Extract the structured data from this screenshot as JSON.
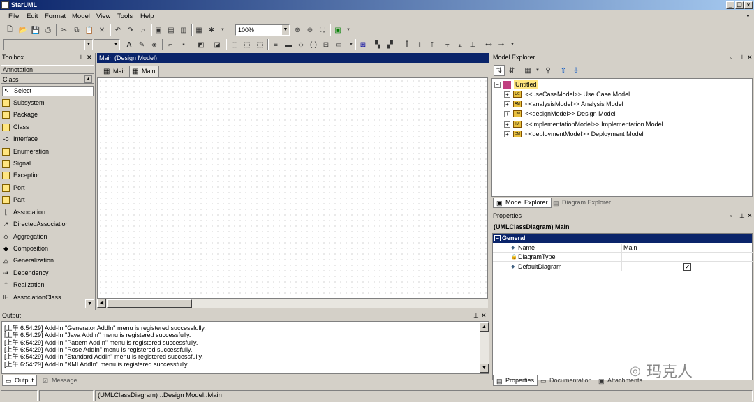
{
  "window": {
    "title": "StarUML"
  },
  "menu": [
    "File",
    "Edit",
    "Format",
    "Model",
    "View",
    "Tools",
    "Help"
  ],
  "toolbar": {
    "zoom": "100%"
  },
  "toolbox": {
    "title": "Toolbox",
    "sections": [
      "Annotation",
      "Class"
    ],
    "items": [
      {
        "label": "Select",
        "icon": "pointer-icon"
      },
      {
        "label": "Subsystem",
        "icon": "subsystem-icon"
      },
      {
        "label": "Package",
        "icon": "package-icon"
      },
      {
        "label": "Class",
        "icon": "class-icon"
      },
      {
        "label": "Interface",
        "icon": "interface-icon"
      },
      {
        "label": "Enumeration",
        "icon": "enumeration-icon"
      },
      {
        "label": "Signal",
        "icon": "signal-icon"
      },
      {
        "label": "Exception",
        "icon": "exception-icon"
      },
      {
        "label": "Port",
        "icon": "port-icon"
      },
      {
        "label": "Part",
        "icon": "part-icon"
      },
      {
        "label": "Association",
        "icon": "association-icon"
      },
      {
        "label": "DirectedAssociation",
        "icon": "directed-association-icon"
      },
      {
        "label": "Aggregation",
        "icon": "aggregation-icon"
      },
      {
        "label": "Composition",
        "icon": "composition-icon"
      },
      {
        "label": "Generalization",
        "icon": "generalization-icon"
      },
      {
        "label": "Dependency",
        "icon": "dependency-icon"
      },
      {
        "label": "Realization",
        "icon": "realization-icon"
      },
      {
        "label": "AssociationClass",
        "icon": "association-class-icon"
      }
    ]
  },
  "diagram": {
    "header": "Main (Design Model)",
    "tabs": [
      "Main",
      "Main"
    ]
  },
  "output": {
    "title": "Output",
    "lines": [
      "[上午 6:54:29]  Add-In \"Generator AddIn\" menu is registered successfully.",
      "[上午 6:54:29]  Add-In \"Java AddIn\" menu is registered successfully.",
      "[上午 6:54:29]  Add-In \"Pattern AddIn\" menu is registered successfully.",
      "[上午 6:54:29]  Add-In \"Rose AddIn\" menu is registered successfully.",
      "[上午 6:54:29]  Add-In \"Standard AddIn\" menu is registered successfully.",
      "[上午 6:54:29]  Add-In \"XMI AddIn\" menu is registered successfully."
    ],
    "tabs": [
      "Output",
      "Message"
    ]
  },
  "model_explorer": {
    "title": "Model Explorer",
    "root": "Untitled",
    "children": [
      {
        "label": "<<useCaseModel>> Use Case Model",
        "badge": "UC"
      },
      {
        "label": "<<analysisModel>> Analysis Model",
        "badge": "AM"
      },
      {
        "label": "<<designModel>> Design Model",
        "badge": "DM"
      },
      {
        "label": "<<implementationModel>> Implementation Model",
        "badge": "IM"
      },
      {
        "label": "<<deploymentModel>> Deployment Model",
        "badge": "DM"
      }
    ],
    "tabs": [
      "Model Explorer",
      "Diagram Explorer"
    ]
  },
  "properties": {
    "title": "Properties",
    "subject": "(UMLClassDiagram) Main",
    "group": "General",
    "rows": [
      {
        "name": "Name",
        "value": "Main"
      },
      {
        "name": "DiagramType",
        "value": ""
      },
      {
        "name": "DefaultDiagram",
        "value": "✔"
      }
    ],
    "tabs": [
      "Properties",
      "Documentation",
      "Attachments"
    ]
  },
  "watermark": "玛克人",
  "status": {
    "path": "(UMLClassDiagram) ::Design Model::Main"
  },
  "colors": {
    "title_active": "#0a246a",
    "face": "#d4d0c8",
    "selection": "#0a246a"
  }
}
